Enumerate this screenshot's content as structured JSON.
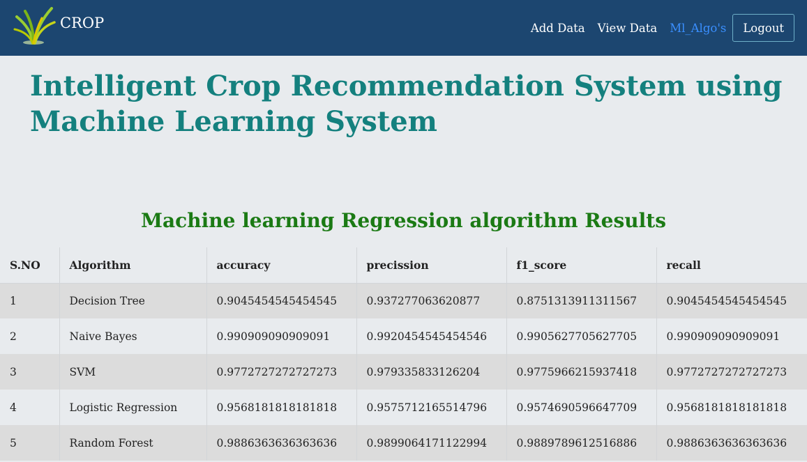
{
  "navbar": {
    "brand": "CROP",
    "links": [
      "Add Data",
      "View Data",
      "Ml_Algo's"
    ],
    "logout_label": "Logout"
  },
  "page_title": "Intelligent Crop Recommendation System using Machine Learning System",
  "section_title": "Machine learning Regression algorithm Results",
  "table": {
    "headers": [
      "S.NO",
      "Algorithm",
      "accuracy",
      "precission",
      "f1_score",
      "recall"
    ],
    "rows": [
      [
        "1",
        "Decision Tree",
        "0.9045454545454545",
        "0.937277063620877",
        "0.8751313911311567",
        "0.9045454545454545"
      ],
      [
        "2",
        "Naive Bayes",
        "0.990909090909091",
        "0.9920454545454546",
        "0.9905627705627705",
        "0.990909090909091"
      ],
      [
        "3",
        "SVM",
        "0.9772727272727273",
        "0.979335833126204",
        "0.9775966215937418",
        "0.9772727272727273"
      ],
      [
        "4",
        "Logistic Regression",
        "0.9568181818181818",
        "0.9575712165514796",
        "0.9574690596647709",
        "0.9568181818181818"
      ],
      [
        "5",
        "Random Forest",
        "0.9886363636363636",
        "0.9899064171122994",
        "0.9889789612516886",
        "0.9886363636363636"
      ]
    ]
  },
  "colors": {
    "navbar": "#1c4670",
    "active_link": "#3a8fff",
    "page_title": "#14807e",
    "section_title": "#1b7a14"
  },
  "icons": {
    "brand_logo": "wheat-plant-icon"
  }
}
